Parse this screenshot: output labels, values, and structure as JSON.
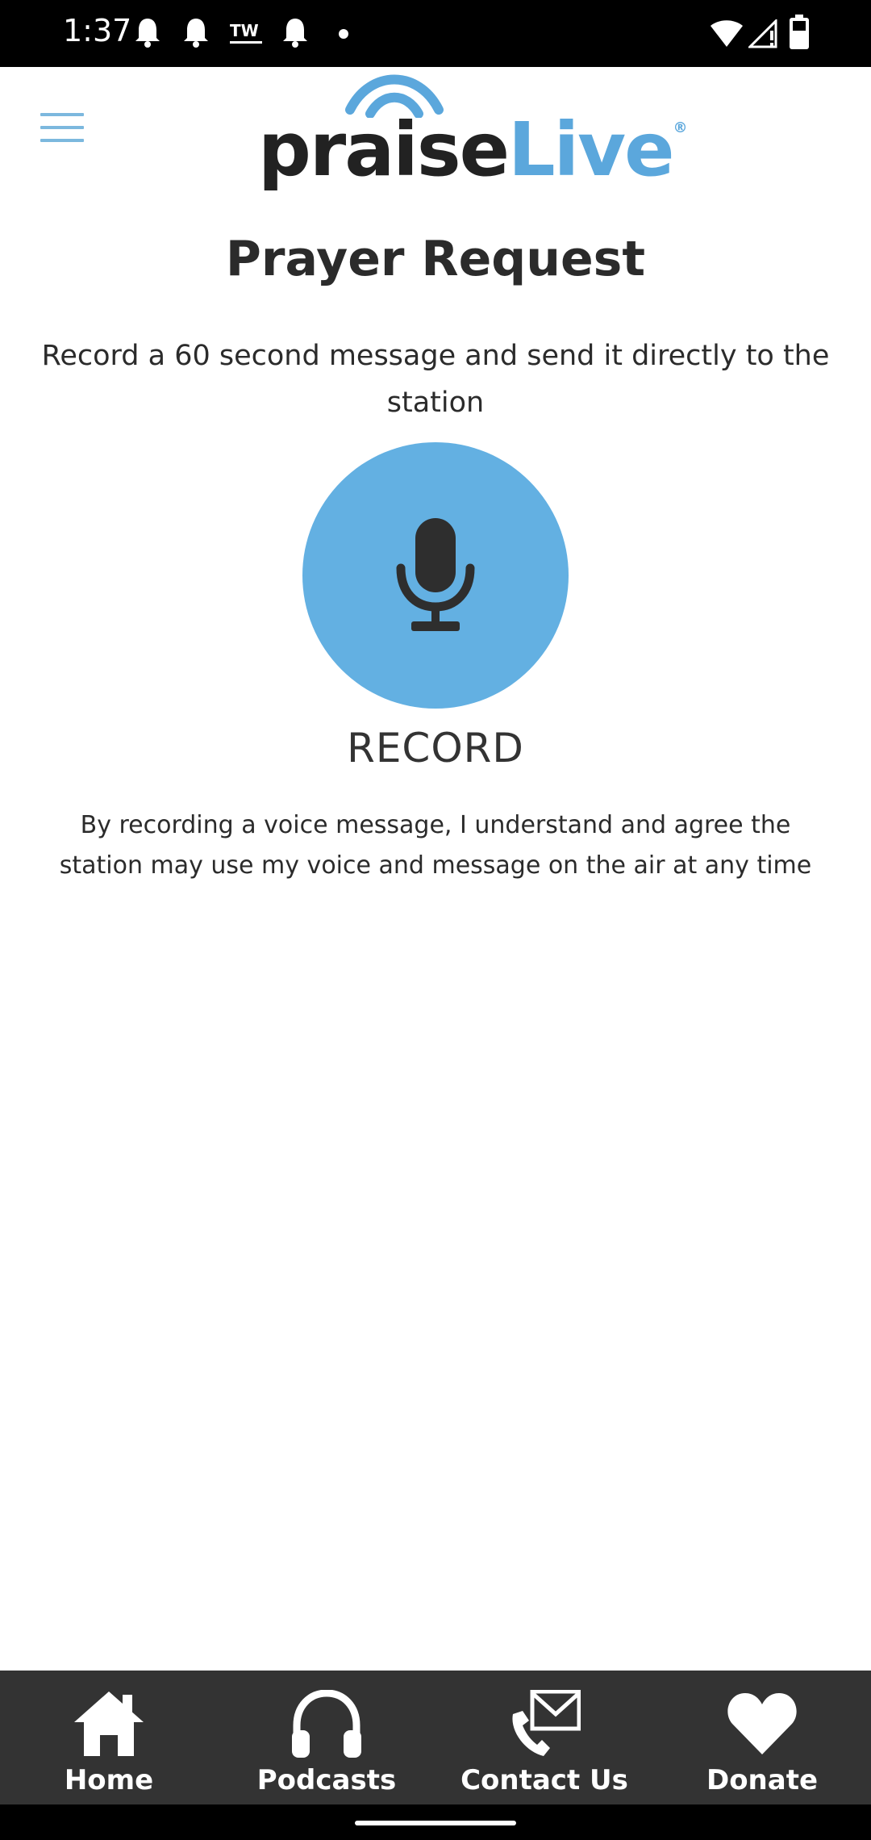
{
  "status_bar": {
    "time": "1:37",
    "left_icons": [
      "bell-icon",
      "bell-icon",
      "tw-icon",
      "bell-icon",
      "dot-icon"
    ],
    "tw_text": "TW",
    "right_icons": [
      "wifi-icon",
      "signal-icon",
      "battery-icon"
    ]
  },
  "header": {
    "menu_icon": "hamburger-menu-icon",
    "logo_text_dark": "praise",
    "logo_text_light": "Live",
    "logo_reg": "®"
  },
  "page": {
    "title": "Prayer Request",
    "instruction": "Record a 60 second message and send it directly to the station",
    "record_label": "RECORD",
    "disclaimer": "By recording a voice message, I understand and agree the station may use my voice and message on the air at any time"
  },
  "bottom_nav": {
    "items": [
      {
        "label": "Home",
        "icon": "home-icon"
      },
      {
        "label": "Podcasts",
        "icon": "headphones-icon"
      },
      {
        "label": "Contact Us",
        "icon": "phone-mail-icon"
      },
      {
        "label": "Donate",
        "icon": "heart-icon"
      }
    ]
  },
  "colors": {
    "accent": "#63b0e2",
    "dark_text": "#2b2b2b",
    "nav_background": "#333333"
  }
}
